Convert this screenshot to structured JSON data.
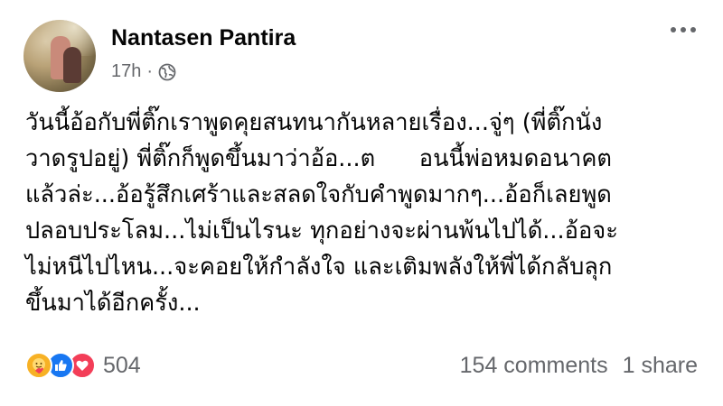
{
  "post": {
    "author": "Nantasen Pantira",
    "time": "17h",
    "separator": "·",
    "lines": [
      "วันนี้อ้อกับพี่ติ๊กเราพูดคุยสนทนากันหลายเรื่อง...จู่ๆ (พี่ติ๊กนั่ง",
      "วาดรูปอยู่) พี่ติ๊กก็พูดขึ้นมาว่าอ้อ...ต      อนนี้พ่อหมดอนาคต",
      "แล้วล่ะ...อ้อรู้สึกเศร้าและสลดใจกับคำพูดมากๆ...อ้อก็เลยพูด",
      "ปลอบประโลม...ไม่เป็นไรนะ ทุกอย่างจะผ่านพ้นไปได้...อ้อจะ",
      "ไม่หนีไปไหน...จะคอยให้กำลังใจ และเติมพลังให้พี่ได้กลับลุก",
      "ขึ้นมาได้อีกครั้ง..."
    ]
  },
  "footer": {
    "reaction_count": "504",
    "comments": "154 comments",
    "shares": "1 share",
    "reaction_icons": [
      "care-icon",
      "like-icon",
      "love-icon"
    ]
  },
  "colors": {
    "text": "#050505",
    "secondary": "#65676b",
    "like": "#1877f2",
    "love": "#f33e58",
    "care": "#f7b125"
  }
}
